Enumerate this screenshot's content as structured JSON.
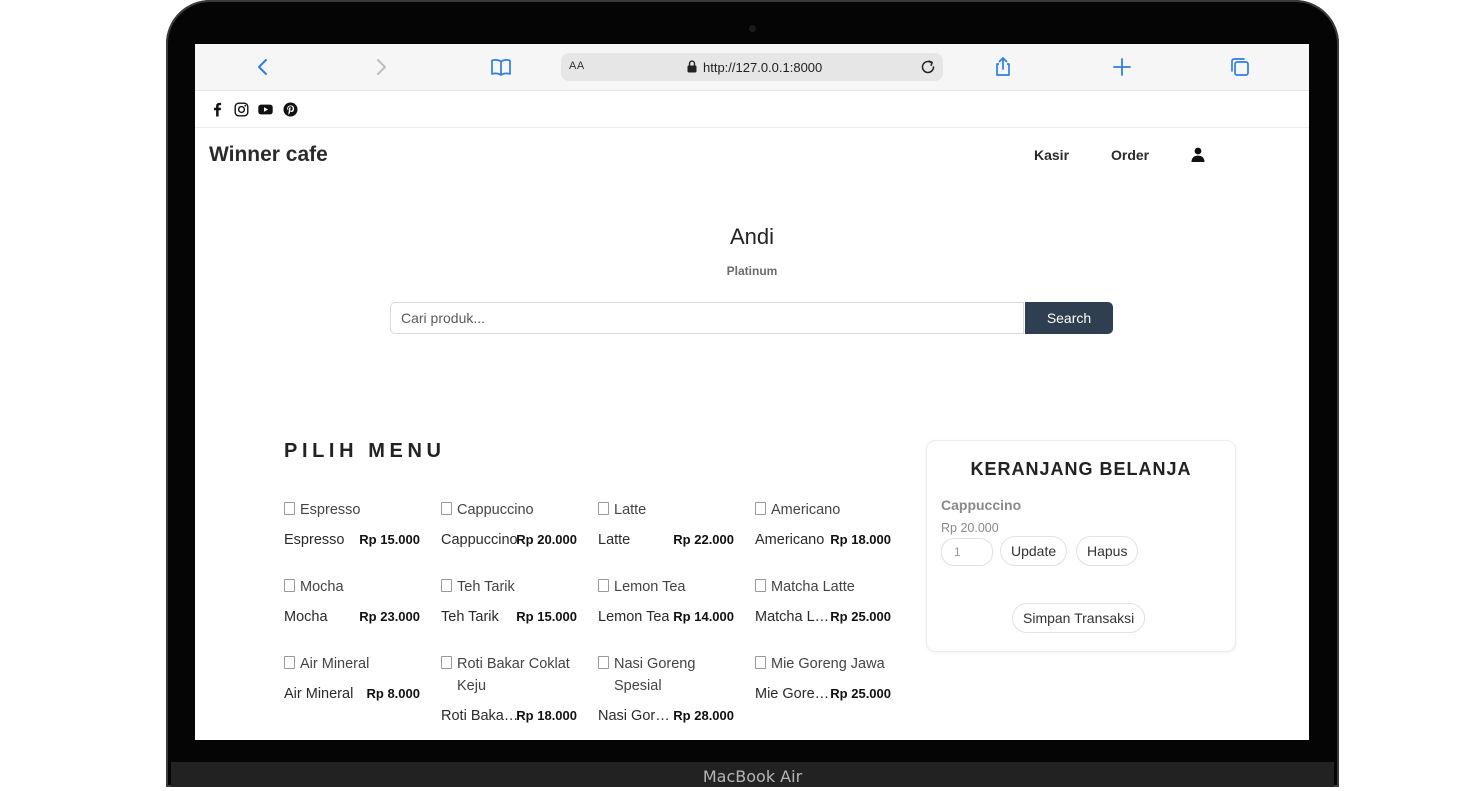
{
  "device": {
    "label": "MacBook Air"
  },
  "browser": {
    "text_size_label": "AA",
    "url": "http://127.0.0.1:8000",
    "icons": [
      "back-icon",
      "forward-icon",
      "bookmarks-icon",
      "lock-icon",
      "reload-icon",
      "share-icon",
      "new-tab-icon",
      "tabs-icon"
    ]
  },
  "social": {
    "icons": [
      "facebook-icon",
      "instagram-icon",
      "youtube-icon",
      "pinterest-icon"
    ]
  },
  "navbar": {
    "brand": "Winner cafe",
    "links": [
      "Kasir",
      "Order"
    ],
    "user_icon": "user-icon"
  },
  "profile": {
    "name": "Andi",
    "tier": "Platinum"
  },
  "search": {
    "placeholder": "Cari produk...",
    "button_label": "Search"
  },
  "menu": {
    "title": "PILIH MENU",
    "products": [
      {
        "image_alt": "Espresso",
        "name": "Espresso",
        "price": "Rp 15.000"
      },
      {
        "image_alt": "Cappuccino",
        "name": "Cappuccino",
        "price": "Rp 20.000"
      },
      {
        "image_alt": "Latte",
        "name": "Latte",
        "price": "Rp 22.000"
      },
      {
        "image_alt": "Americano",
        "name": "Americano",
        "price": "Rp 18.000"
      },
      {
        "image_alt": "Mocha",
        "name": "Mocha",
        "price": "Rp 23.000"
      },
      {
        "image_alt": "Teh Tarik",
        "name": "Teh Tarik",
        "price": "Rp 15.000"
      },
      {
        "image_alt": "Lemon Tea",
        "name": "Lemon Tea",
        "price": "Rp 14.000"
      },
      {
        "image_alt": "Matcha Latte",
        "name": "Matcha Latte",
        "price": "Rp 25.000"
      },
      {
        "image_alt": "Air Mineral",
        "name": "Air Mineral",
        "price": "Rp 8.000"
      },
      {
        "image_alt": "Roti Bakar Coklat Keju",
        "name": "Roti Bakar Coklat Keju",
        "price": "Rp 18.000"
      },
      {
        "image_alt": "Nasi Goreng Spesial",
        "name": "Nasi Goreng Spesial",
        "price": "Rp 28.000"
      },
      {
        "image_alt": "Mie Goreng Jawa",
        "name": "Mie Goreng Jawa",
        "price": "Rp 25.000"
      }
    ]
  },
  "cart": {
    "title": "KERANJANG BELANJA",
    "items": [
      {
        "name": "Cappuccino",
        "price": "Rp 20.000",
        "quantity": "1"
      }
    ],
    "update_label": "Update",
    "remove_label": "Hapus",
    "save_label": "Simpan Transaksi"
  }
}
